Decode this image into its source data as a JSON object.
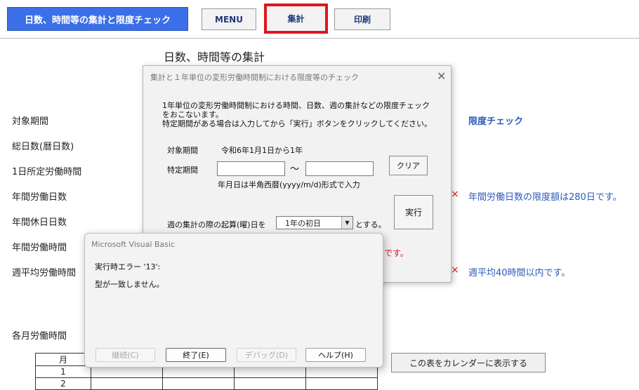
{
  "toolbar": {
    "title": "日数、時間等の集計と限度チェック",
    "menu": "MENU",
    "tally": "集計",
    "print": "印刷",
    "accent": "#3b6fe8",
    "highlight": "#e0161d"
  },
  "sheet": {
    "title": "日数、時間等の集計",
    "labels": [
      "対象期間",
      "総日数(暦日数)",
      "1日所定労働時間",
      "年間労働日数",
      "年間休日日数",
      "年間労働時間",
      "週平均労働時間"
    ],
    "limit_check": "限度チェック",
    "limit_days": "年間労働日数の限度額は280日です。",
    "limit_week": "週平均40時間以内です。",
    "x_mark": "×",
    "monthly_label": "各月労働時間",
    "table": {
      "header": "月",
      "rows": [
        "1",
        "2"
      ]
    },
    "calendar_button": "この表をカレンダーに表示する"
  },
  "dialog1": {
    "title": "集計と１年単位の変形労働時間制における限度等のチェック",
    "desc": [
      "1年単位の変形労働時間制における時間、日数、週の集計などの限度チェック",
      "をおこないます。",
      "特定期間がある場合は入力してから「実行」ボタンをクリックしてください。"
    ],
    "period_label": "対象期間",
    "period_value": "令和6年1月1日から1年",
    "specific_label": "特定期間",
    "specific_from": "",
    "specific_to": "",
    "tilde": "～",
    "clear": "クリア",
    "date_hint": "年月日は半角西暦(yyyy/m/d)形式で入力",
    "execute": "実行",
    "week_start_label": "週の集計の際の起算(曜)日を",
    "week_start_value": "1年の初日",
    "week_start_suffix": "とする。",
    "red_text_tail": "です。"
  },
  "dialog2": {
    "title": "Microsoft Visual Basic",
    "error_line": "実行時エラー '13':",
    "message": "型が一致しません。",
    "continue": "継続(C)",
    "end": "終了(E)",
    "debug": "デバッグ(D)",
    "help": "ヘルプ(H)"
  }
}
